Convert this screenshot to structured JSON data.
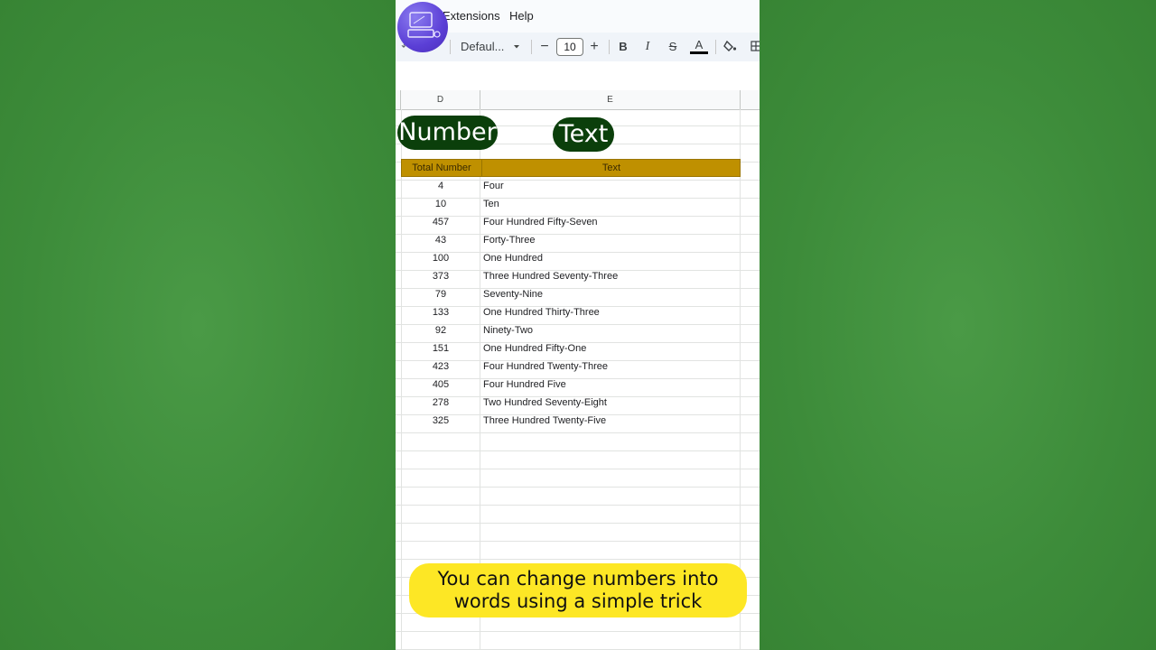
{
  "menu": {
    "extensions": "Extensions",
    "help": "Help"
  },
  "toolbar": {
    "font_name": "Defaul...",
    "font_size": "10",
    "minus": "−",
    "plus": "+",
    "bold": "B",
    "italic": "I",
    "strike": "S",
    "text_color": "A",
    "dropdown_icon": "chevron-down-icon"
  },
  "columns": {
    "d": "D",
    "e": "E"
  },
  "labels": {
    "number": "Number",
    "text": "Text"
  },
  "table": {
    "headers": [
      "Total Number",
      "Text"
    ],
    "rows": [
      {
        "num": "4",
        "text": "Four"
      },
      {
        "num": "10",
        "text": "Ten"
      },
      {
        "num": "457",
        "text": "Four Hundred Fifty-Seven"
      },
      {
        "num": "43",
        "text": "Forty-Three"
      },
      {
        "num": "100",
        "text": "One Hundred"
      },
      {
        "num": "373",
        "text": "Three Hundred Seventy-Three"
      },
      {
        "num": "79",
        "text": "Seventy-Nine"
      },
      {
        "num": "133",
        "text": "One Hundred Thirty-Three"
      },
      {
        "num": "92",
        "text": "Ninety-Two"
      },
      {
        "num": "151",
        "text": "One Hundred Fifty-One"
      },
      {
        "num": "423",
        "text": "Four Hundred Twenty-Three"
      },
      {
        "num": "405",
        "text": "Four Hundred Five"
      },
      {
        "num": "278",
        "text": "Two Hundred Seventy-Eight"
      },
      {
        "num": "325",
        "text": "Three Hundred Twenty-Five"
      }
    ]
  },
  "caption": {
    "line1": "You can change numbers into",
    "line2": "words using a simple trick"
  },
  "colors": {
    "background_green": "#3f8f3c",
    "header_gold": "#bf9000",
    "pill_green": "#0b3f0b",
    "caption_yellow": "#fde725"
  }
}
